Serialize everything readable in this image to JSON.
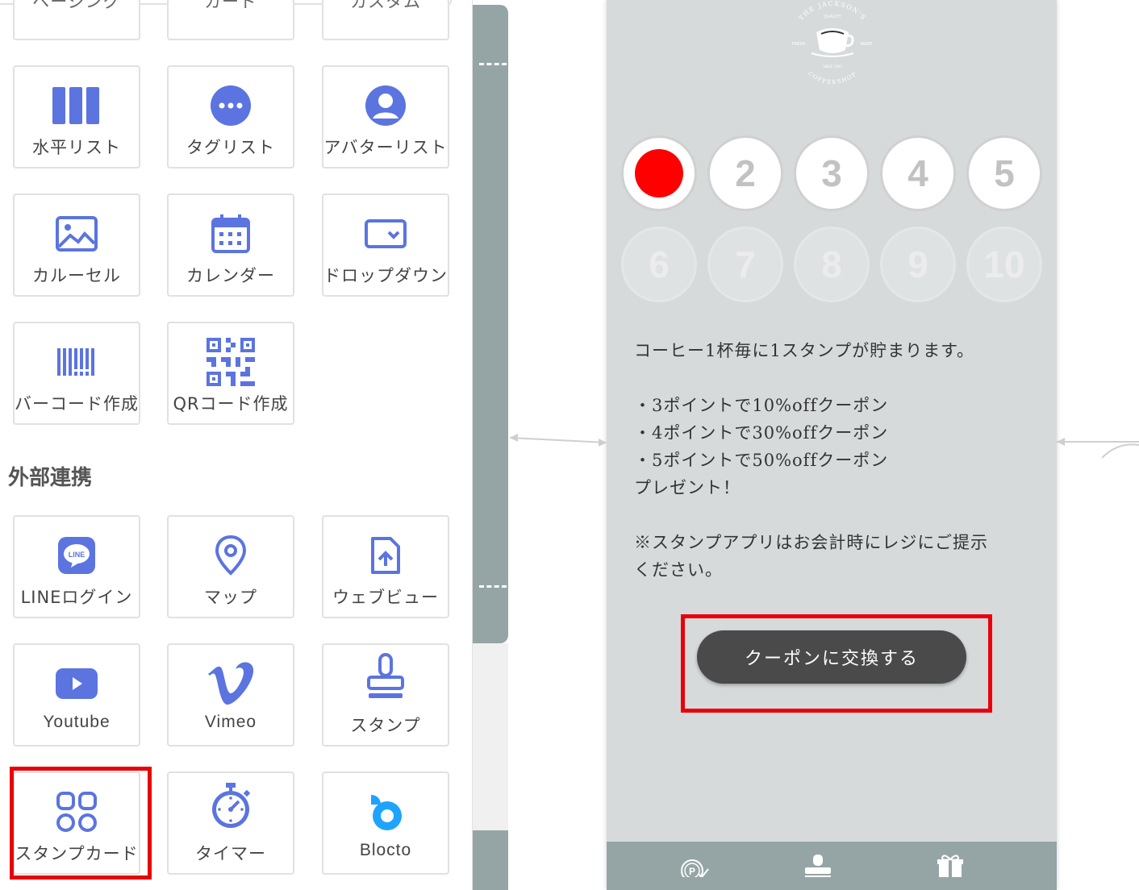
{
  "palette": {
    "top_row_labels": [
      "ページング",
      "カード",
      "カスタム"
    ],
    "rows": [
      [
        {
          "label": "水平リスト",
          "icon": "horizontal-list-icon"
        },
        {
          "label": "タグリスト",
          "icon": "tag-list-icon"
        },
        {
          "label": "アバターリスト",
          "icon": "avatar-list-icon"
        }
      ],
      [
        {
          "label": "カルーセル",
          "icon": "carousel-icon"
        },
        {
          "label": "カレンダー",
          "icon": "calendar-icon"
        },
        {
          "label": "ドロップダウン",
          "icon": "dropdown-icon"
        }
      ],
      [
        {
          "label": "バーコード作成",
          "icon": "barcode-icon"
        },
        {
          "label": "QRコード作成",
          "icon": "qr-code-icon"
        }
      ]
    ],
    "section_heading": "外部連携",
    "external_rows": [
      [
        {
          "label": "LINEログイン",
          "icon": "line-icon"
        },
        {
          "label": "マップ",
          "icon": "map-pin-icon"
        },
        {
          "label": "ウェブビュー",
          "icon": "webview-icon"
        }
      ],
      [
        {
          "label": "Youtube",
          "icon": "youtube-icon"
        },
        {
          "label": "Vimeo",
          "icon": "vimeo-icon"
        },
        {
          "label": "スタンプ",
          "icon": "stamp-icon"
        }
      ],
      [
        {
          "label": "スタンプカード",
          "icon": "stamp-card-icon"
        },
        {
          "label": "タイマー",
          "icon": "timer-icon"
        },
        {
          "label": "Blocto",
          "icon": "blocto-icon"
        }
      ]
    ],
    "line_icon_text": "LINE",
    "accent_color": "#5b74e0",
    "highlight_color": "#e8000b"
  },
  "phone": {
    "logo": {
      "top": "THE JACKSON'S",
      "sub": "QUALITY",
      "left": "FRESH",
      "right": "MADE",
      "since": "SINCE 1900",
      "bottom": "COFFEESHOP"
    },
    "stamps": [
      "",
      "2",
      "3",
      "4",
      "5",
      "6",
      "7",
      "8",
      "9",
      "10"
    ],
    "stamped_count": 1,
    "description": [
      "コーヒー1杯毎に1スタンプが貯まります。",
      "",
      "・3ポイントで10%offクーポン",
      "・4ポイントで30%offクーポン",
      "・5ポイントで50%offクーポン",
      "プレゼント！",
      "",
      "※スタンプアプリはお会計時にレジにご提示",
      "ください。"
    ],
    "coupon_button": "クーポンに交換する",
    "tabs": [
      "point-tab-icon",
      "stamp-tab-icon",
      "gift-tab-icon"
    ],
    "stamp_color": "#ff0000",
    "background": "#d6dadb",
    "tabbar_color": "#95a5a6"
  }
}
